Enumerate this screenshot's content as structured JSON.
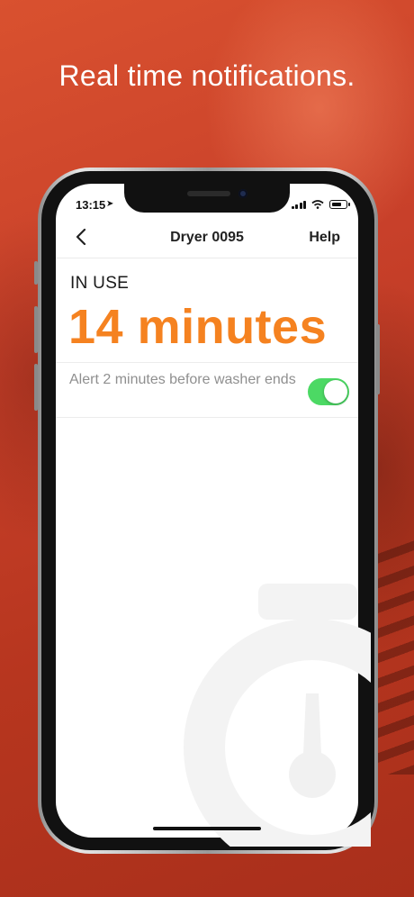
{
  "headline": "Real time notifications.",
  "status_bar": {
    "time": "13:15",
    "location_glyph": "➤"
  },
  "nav": {
    "back_icon": "chevron-left-icon",
    "title": "Dryer 0095",
    "help": "Help"
  },
  "machine": {
    "status": "IN USE",
    "time_remaining": "14 minutes",
    "alert_text": "Alert 2 minutes before washer ends",
    "alert_enabled": true
  },
  "colors": {
    "background": "#c23a22",
    "accent": "#f58220",
    "toggle_on": "#4cd964"
  }
}
